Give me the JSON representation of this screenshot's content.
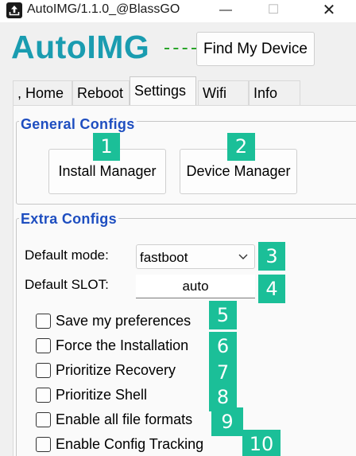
{
  "window": {
    "title": "AutoIMG/1.1.0_@BlassGO",
    "minimize_glyph": "—",
    "maximize_glyph": "☐",
    "close_glyph": "✕"
  },
  "header": {
    "logo": "AutoIMG",
    "find_device_label": "Find My Device"
  },
  "tabs": [
    {
      "label": ", Home"
    },
    {
      "label": "Reboot"
    },
    {
      "label": "Settings",
      "active": true
    },
    {
      "label": "Wifi"
    },
    {
      "label": "Info"
    }
  ],
  "general": {
    "title": "General Configs",
    "install_manager_label": "Install Manager",
    "device_manager_label": "Device Manager"
  },
  "extra": {
    "title": "Extra Configs",
    "default_mode_label": "Default mode:",
    "default_mode_value": "fastboot",
    "default_slot_label": "Default SLOT:",
    "default_slot_value": "auto",
    "checkboxes": [
      {
        "label": "Save my preferences",
        "checked": false
      },
      {
        "label": "Force the Installation",
        "checked": false
      },
      {
        "label": "Prioritize Recovery",
        "checked": false
      },
      {
        "label": "Prioritize Shell",
        "checked": false
      },
      {
        "label": "Enable all file formats",
        "checked": false
      },
      {
        "label": "Enable Config Tracking",
        "checked": false
      }
    ]
  },
  "annotations": [
    "1",
    "2",
    "3",
    "4",
    "5",
    "6",
    "7",
    "8",
    "9",
    "10"
  ],
  "colors": {
    "logo": "#1a9cb0",
    "group_title": "#1e4ec0",
    "badge": "#1bbf98",
    "connector": "#2aa52a"
  }
}
